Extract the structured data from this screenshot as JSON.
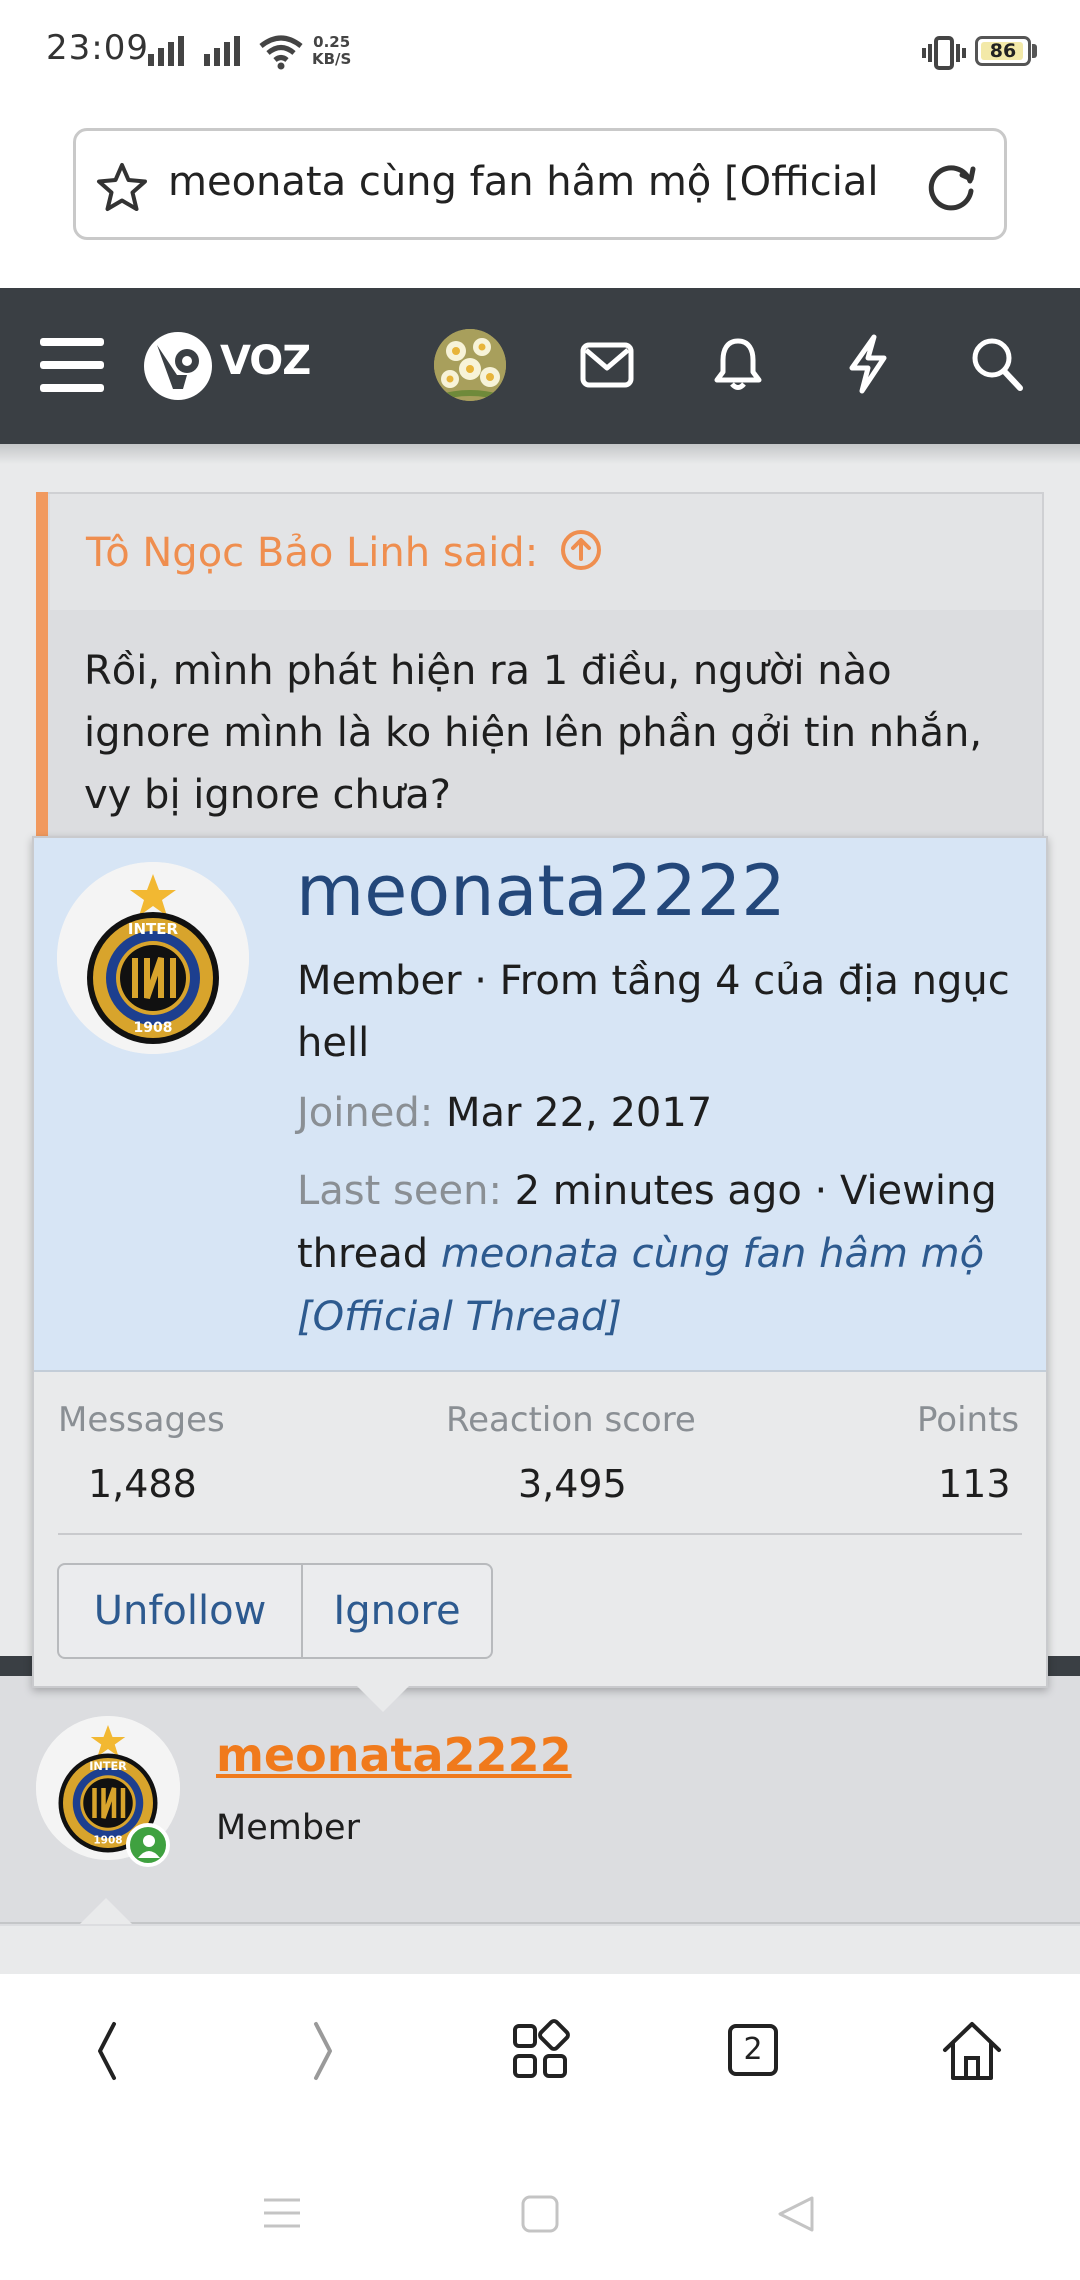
{
  "status_bar": {
    "time": "23:09",
    "speed_value": "0.25",
    "speed_unit": "KB/S",
    "battery": "86"
  },
  "url_bar": {
    "title": "meonata cùng fan hâm mộ [Official ...",
    "icons": [
      "star-icon",
      "reload-icon"
    ]
  },
  "header": {
    "logo_text": "VOZ",
    "icons": [
      "menu-icon",
      "avatar",
      "inbox-icon",
      "alerts-bell-icon",
      "whats-new-bolt-icon",
      "search-icon"
    ]
  },
  "quote": {
    "author": "Tô Ngọc Bảo Linh said:",
    "body": "Rồi, mình phát hiện ra 1 điều, người nào ignore mình là ko hiện lên phần gởi tin nhắn, vy bị ignore chưa?"
  },
  "member_card": {
    "username": "meonata2222",
    "member_line": "Member · From tầng 4 của địa ngục hell",
    "joined_label": "Joined:",
    "joined_value": "Mar 22, 2017",
    "last_seen_label": "Last seen:",
    "last_seen_value": "2 minutes ago · Viewing thread",
    "thread_link": "meonata cùng fan hâm mộ [Official Thread]",
    "stats": [
      {
        "label": "Messages",
        "value": "1,488"
      },
      {
        "label": "Reaction score",
        "value": "3,495"
      },
      {
        "label": "Points",
        "value": "113"
      }
    ],
    "buttons": {
      "unfollow": "Unfollow",
      "ignore": "Ignore"
    }
  },
  "post": {
    "username": "meonata2222",
    "role": "Member"
  },
  "bottom_nav": {
    "tab_count": "2",
    "icons": [
      "back-icon",
      "forward-icon",
      "apps-icon",
      "tabs-icon",
      "home-icon"
    ]
  },
  "colors": {
    "header_bg": "#3a3f44",
    "quote_accent": "#f1995e",
    "card_top_bg": "#d7e5f5",
    "username_blue": "#23477a",
    "link_blue": "#2d5a8f",
    "post_username": "#f07a1c",
    "online_green": "#3fa140"
  }
}
